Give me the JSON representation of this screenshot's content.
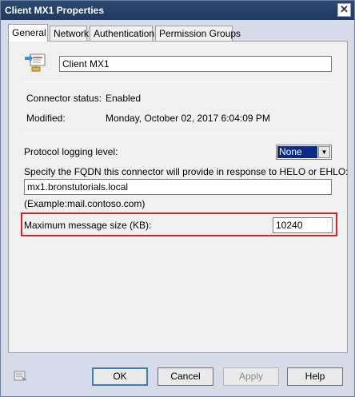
{
  "window": {
    "title": "Client MX1 Properties",
    "close_glyph": "✕"
  },
  "tabs": [
    {
      "label": "General",
      "active": true
    },
    {
      "label": "Network"
    },
    {
      "label": "Authentication"
    },
    {
      "label": "Permission Groups"
    }
  ],
  "general": {
    "connector_name": "Client MX1",
    "connector_icon": "connector-icon",
    "status_label": "Connector status:",
    "status_value": "Enabled",
    "modified_label": "Modified:",
    "modified_value": "Monday, October 02, 2017 6:04:09 PM",
    "logging_label": "Protocol logging level:",
    "logging_value": "None",
    "fqdn_label": "Specify the FQDN this connector will provide in response to HELO or EHLO:",
    "fqdn_value": "mx1.bronstutorials.local",
    "fqdn_example": "(Example:mail.contoso.com)",
    "max_size_label": "Maximum message size (KB):",
    "max_size_value": "10240"
  },
  "buttons": {
    "ok": "OK",
    "cancel": "Cancel",
    "apply": "Apply",
    "help": "Help"
  },
  "colors": {
    "highlight": "#d9242b",
    "titlebar": "#1f3a60",
    "selected": "#0a2a8a"
  }
}
